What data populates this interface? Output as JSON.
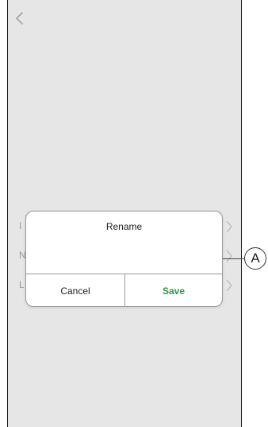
{
  "background_rows": [
    {
      "letter": "I"
    },
    {
      "letter": "N"
    },
    {
      "letter": "L"
    }
  ],
  "dialog": {
    "title": "Rename",
    "input_value": "",
    "cancel_label": "Cancel",
    "save_label": "Save"
  },
  "callout": {
    "label": "A"
  },
  "colors": {
    "save": "#2b9a3d",
    "border": "#9a9a9a",
    "dim_background": "#e6e6e6"
  }
}
